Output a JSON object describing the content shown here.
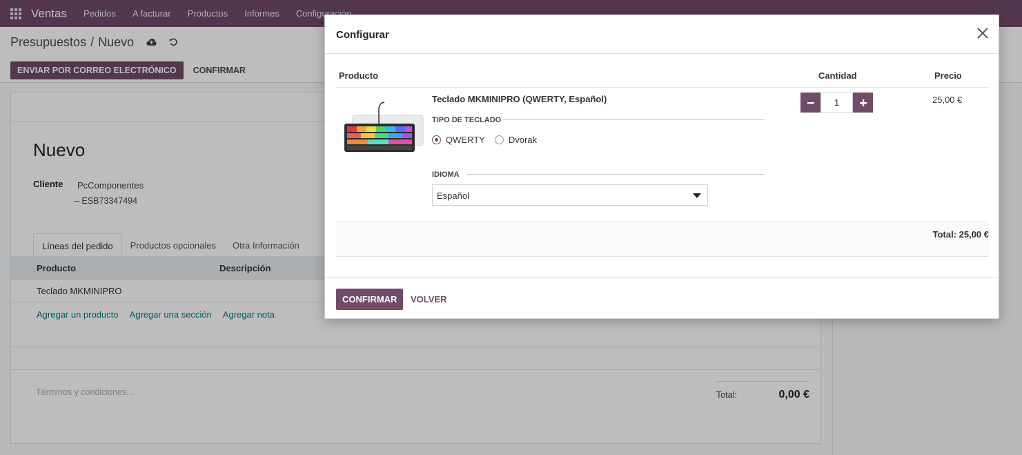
{
  "navbar": {
    "app": "Ventas",
    "items": [
      "Pedidos",
      "A facturar",
      "Productos",
      "Informes",
      "Configuración"
    ]
  },
  "control": {
    "breadcrumb_parent": "Presupuestos",
    "breadcrumb_sep": "/",
    "breadcrumb_current": "Nuevo",
    "send_email": "Enviar por correo electrónico",
    "confirm": "Confirmar"
  },
  "form": {
    "title": "Nuevo",
    "client_label": "Cliente",
    "client_name": "PcComponentes",
    "client_vat": "– ESB73347494",
    "tabs": [
      "Líneas del pedido",
      "Productos opcionales",
      "Otra Información"
    ],
    "col_product": "Producto",
    "col_description": "Descripción",
    "line_product": "Teclado MKMINIPRO",
    "add_product": "Agregar un producto",
    "add_section": "Agregar una sección",
    "add_note": "Agregar nota",
    "terms_placeholder": "Términos y condiciones...",
    "total_label": "Total:",
    "total_value": "0,00 €"
  },
  "modal": {
    "title": "Configurar",
    "col_product": "Producto",
    "col_quantity": "Cantidad",
    "col_price": "Precio",
    "product_name": "Teclado MKMINIPRO (QWERTY, Español)",
    "attr_keyboard_label": "Tipo de teclado",
    "option_qwerty": "QWERTY",
    "option_dvorak": "Dvorak",
    "selected_option": "QWERTY",
    "attr_language_label": "Idioma",
    "language_value": "Español",
    "quantity": "1",
    "price": "25,00 €",
    "total": "Total: 25,00 €",
    "confirm": "Confirmar",
    "back": "Volver"
  },
  "colors": {
    "brand": "#714b67",
    "link": "#017e84"
  },
  "icons": [
    "apps-icon",
    "cloud-save-icon",
    "undo-icon",
    "close-icon",
    "minus-icon",
    "plus-icon",
    "chevron-down-icon"
  ]
}
